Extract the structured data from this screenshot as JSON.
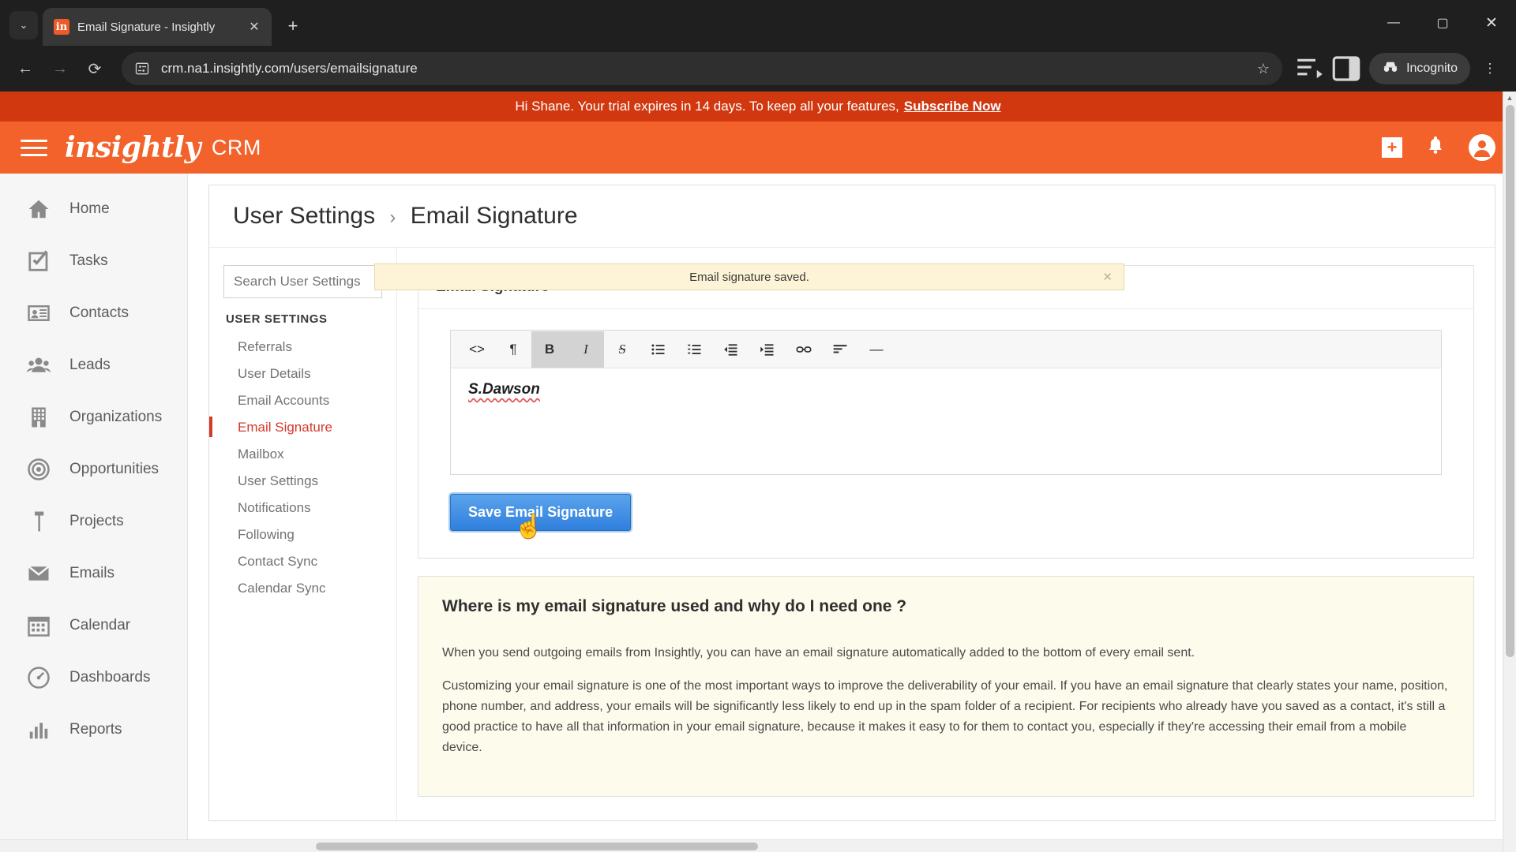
{
  "browser": {
    "tab": {
      "title": "Email Signature - Insightly",
      "favicon_letter": "in",
      "close_icon": "✕"
    },
    "tab_list_icon": "⌄",
    "new_tab_icon": "+",
    "window_controls": {
      "minimize": "—",
      "maximize": "▢",
      "close": "✕"
    },
    "nav": {
      "back": "←",
      "forward": "→",
      "reload": "⟳"
    },
    "omnibox": {
      "url": "crm.na1.insightly.com/users/emailsignature",
      "site_icon": "site-settings",
      "star_icon": "☆"
    },
    "toolbar_icons": {
      "reading_list": "reading-list",
      "side_panel": "side-panel",
      "menu": "⋮"
    },
    "incognito": {
      "label": "Incognito",
      "icon": "incognito-hat"
    }
  },
  "trial_banner": {
    "message": "Hi Shane. Your trial expires in 14 days. To keep all your features,",
    "link": "Subscribe Now"
  },
  "app_header": {
    "brand": "insightly",
    "brand_sub": "CRM",
    "toast": {
      "message": "Email signature saved.",
      "close": "✕"
    },
    "add_icon": "+",
    "bell_icon": "bell",
    "avatar_icon": "user-avatar"
  },
  "sidebar": {
    "items": [
      {
        "label": "Home",
        "icon": "home-icon"
      },
      {
        "label": "Tasks",
        "icon": "tasks-check-icon"
      },
      {
        "label": "Contacts",
        "icon": "contacts-card-icon"
      },
      {
        "label": "Leads",
        "icon": "leads-people-icon"
      },
      {
        "label": "Organizations",
        "icon": "building-icon"
      },
      {
        "label": "Opportunities",
        "icon": "target-icon"
      },
      {
        "label": "Projects",
        "icon": "hammer-icon"
      },
      {
        "label": "Emails",
        "icon": "envelope-icon"
      },
      {
        "label": "Calendar",
        "icon": "calendar-icon"
      },
      {
        "label": "Dashboards",
        "icon": "gauge-icon"
      },
      {
        "label": "Reports",
        "icon": "bar-chart-icon"
      }
    ]
  },
  "page": {
    "breadcrumb_parent": "User Settings",
    "breadcrumb_sep": "›",
    "breadcrumb_current": "Email Signature"
  },
  "settings_nav": {
    "search_placeholder": "Search User Settings",
    "search_value": "",
    "search_icon": "search-icon",
    "heading": "USER SETTINGS",
    "items": [
      {
        "label": "Referrals",
        "active": false
      },
      {
        "label": "User Details",
        "active": false
      },
      {
        "label": "Email Accounts",
        "active": false
      },
      {
        "label": "Email Signature",
        "active": true
      },
      {
        "label": "Mailbox",
        "active": false
      },
      {
        "label": "User Settings",
        "active": false
      },
      {
        "label": "Notifications",
        "active": false
      },
      {
        "label": "Following",
        "active": false
      },
      {
        "label": "Contact Sync",
        "active": false
      },
      {
        "label": "Calendar Sync",
        "active": false
      }
    ]
  },
  "signature_panel": {
    "title": "Email Signature",
    "toolbar": [
      {
        "name": "code-view-icon",
        "glyph": "<>",
        "active": false
      },
      {
        "name": "paragraph-icon",
        "glyph": "¶",
        "active": false
      },
      {
        "name": "bold-icon",
        "glyph": "B",
        "active": true
      },
      {
        "name": "italic-icon",
        "glyph": "I",
        "active": true
      },
      {
        "name": "strikethrough-icon",
        "glyph": "S",
        "active": false
      },
      {
        "name": "bullet-list-icon",
        "glyph": "list-ul",
        "active": false
      },
      {
        "name": "numbered-list-icon",
        "glyph": "list-ol",
        "active": false
      },
      {
        "name": "outdent-icon",
        "glyph": "outdent",
        "active": false
      },
      {
        "name": "indent-icon",
        "glyph": "indent",
        "active": false
      },
      {
        "name": "link-icon",
        "glyph": "link",
        "active": false
      },
      {
        "name": "align-icon",
        "glyph": "align",
        "active": false
      },
      {
        "name": "horizontal-rule-icon",
        "glyph": "—",
        "active": false
      }
    ],
    "content": "S.Dawson",
    "save_label": "Save Email Signature",
    "cursor": "hand-pointer"
  },
  "help_panel": {
    "title": "Where is my email signature used and why do I need one ?",
    "paragraph1": "When you send outgoing emails from Insightly, you can have an email signature automatically added to the bottom of every email sent.",
    "paragraph2": "Customizing your email signature is one of the most important ways to improve the deliverability of your email. If you have an email signature that clearly states your name, position, phone number, and address, your emails will be significantly less likely to end up in the spam folder of a recipient. For recipients who already have you saved as a contact, it's still a good practice to have all that information in your email signature, because it makes it easy to for them to contact you, especially if they're accessing their email from a mobile device."
  },
  "colors": {
    "brand_orange": "#f2622a",
    "banner_red": "#d1380f",
    "active_red": "#d4392a",
    "save_blue": "#2f7fdd",
    "toast_bg": "#fdf3d6",
    "help_bg": "#fcfbec"
  }
}
